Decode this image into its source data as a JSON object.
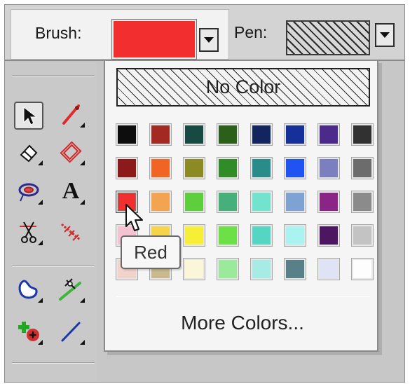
{
  "toolbar": {
    "brush_label": "Brush:",
    "brush_color": "#f22e2e",
    "pen_label": "Pen:"
  },
  "tools": [
    {
      "name": "pointer-tool-button",
      "icon": "arrow-pointer-icon",
      "selected": true
    },
    {
      "name": "line-tool-button",
      "icon": "line-icon"
    },
    {
      "name": "eraser-tool-button",
      "icon": "eraser-icon"
    },
    {
      "name": "rectangle-tool-button",
      "icon": "rectangle-icon"
    },
    {
      "name": "lasso-tool-button",
      "icon": "lasso-icon"
    },
    {
      "name": "text-tool-button",
      "icon": "text-a-icon",
      "text": "A"
    },
    {
      "name": "scissors-tool-button",
      "icon": "scissors-icon"
    },
    {
      "name": "cut-line-tool-button",
      "icon": "cut-line-icon"
    },
    {
      "name": "freeform-shape-tool-button",
      "icon": "freeform-shape-icon"
    },
    {
      "name": "connector-tool-button",
      "icon": "connector-icon"
    },
    {
      "name": "add-point-tool-button",
      "icon": "add-point-icon"
    },
    {
      "name": "diagonal-line-tool-button",
      "icon": "diagonal-line-icon"
    }
  ],
  "color_picker": {
    "no_color_label": "No Color",
    "more_colors_label": "More Colors...",
    "hovered_tooltip": "Red",
    "swatches": [
      [
        "#0d0d0d",
        "#a32a22",
        "#184a44",
        "#2b5f1a",
        "#13255e",
        "#16309a",
        "#4b2a8c",
        "#313131"
      ],
      [
        "#8c1a1a",
        "#f06424",
        "#8c8a23",
        "#2f8c27",
        "#2a8c8a",
        "#1f54f2",
        "#7b7fc0",
        "#6c6c6c"
      ],
      [
        "#f12f2f",
        "#f4a350",
        "#5fce3d",
        "#47b07a",
        "#72e3cc",
        "#7ea3d2",
        "#8a2487",
        "#8b8b8b"
      ],
      [
        "#f4c2d0",
        "#f6d44a",
        "#f7ef37",
        "#6de047",
        "#55d6c2",
        "#a9f3f0",
        "#4d1660",
        "#c3c3c3"
      ],
      [
        "#f1d3cb",
        "#c9b98e",
        "#fbf6d7",
        "#9be99b",
        "#a7ebe5",
        "#598088",
        "#e0e3f5",
        "#fdfdfd"
      ]
    ]
  }
}
